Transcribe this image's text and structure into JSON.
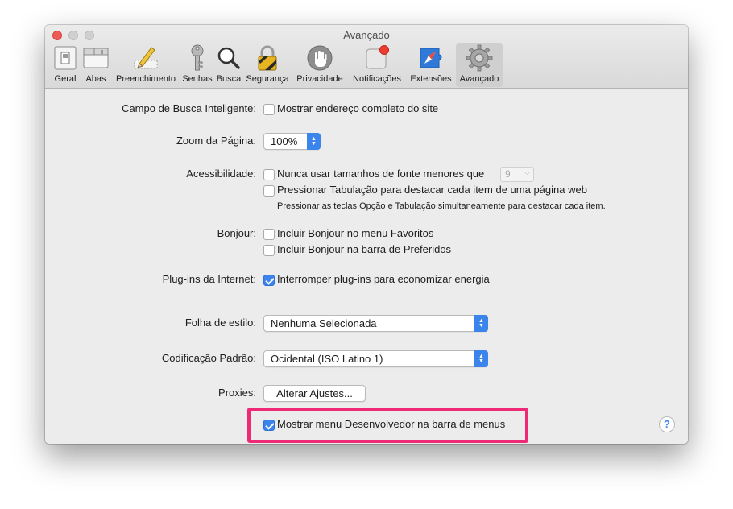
{
  "window": {
    "title": "Avançado"
  },
  "toolbar": {
    "items": [
      {
        "label": "Geral",
        "icon": "switch-icon"
      },
      {
        "label": "Abas",
        "icon": "tabs-icon"
      },
      {
        "label": "Preenchimento",
        "icon": "pencil-icon"
      },
      {
        "label": "Senhas",
        "icon": "key-icon"
      },
      {
        "label": "Busca",
        "icon": "magnifier-icon"
      },
      {
        "label": "Segurança",
        "icon": "padlock-icon"
      },
      {
        "label": "Privacidade",
        "icon": "hand-icon"
      },
      {
        "label": "Notificações",
        "icon": "notification-icon"
      },
      {
        "label": "Extensões",
        "icon": "puzzle-compass-icon"
      },
      {
        "label": "Avançado",
        "icon": "gear-icon",
        "active": true
      }
    ]
  },
  "settings": {
    "smart_search": {
      "label": "Campo de Busca Inteligente:",
      "checkbox": "Mostrar endereço completo do site",
      "checked": false
    },
    "zoom": {
      "label": "Zoom da Página:",
      "value": "100%"
    },
    "accessibility": {
      "label": "Acessibilidade:",
      "font_checkbox": "Nunca usar tamanhos de fonte menores que",
      "font_checked": false,
      "font_size": "9",
      "tab_checkbox": "Pressionar Tabulação para destacar cada item de uma página web",
      "tab_checked": false,
      "tab_hint": "Pressionar as teclas Opção e Tabulação simultaneamente para destacar cada item."
    },
    "bonjour": {
      "label": "Bonjour:",
      "favorites": "Incluir Bonjour no menu Favoritos",
      "favorites_checked": false,
      "bookmarks_bar": "Incluir Bonjour na barra de Preferidos",
      "bookmarks_bar_checked": false
    },
    "plugins": {
      "label": "Plug-ins da Internet:",
      "checkbox": "Interromper plug-ins para economizar energia",
      "checked": true
    },
    "stylesheet": {
      "label": "Folha de estilo:",
      "value": "Nenhuma Selecionada"
    },
    "encoding": {
      "label": "Codificação Padrão:",
      "value": "Ocidental (ISO Latino 1)"
    },
    "proxies": {
      "label": "Proxies:",
      "button": "Alterar Ajustes..."
    },
    "develop_menu": {
      "checkbox": "Mostrar menu Desenvolvedor na barra de menus",
      "checked": true
    }
  },
  "help": {
    "label": "?"
  },
  "colors": {
    "accent": "#3b84ec",
    "highlight": "#ee2a77"
  }
}
